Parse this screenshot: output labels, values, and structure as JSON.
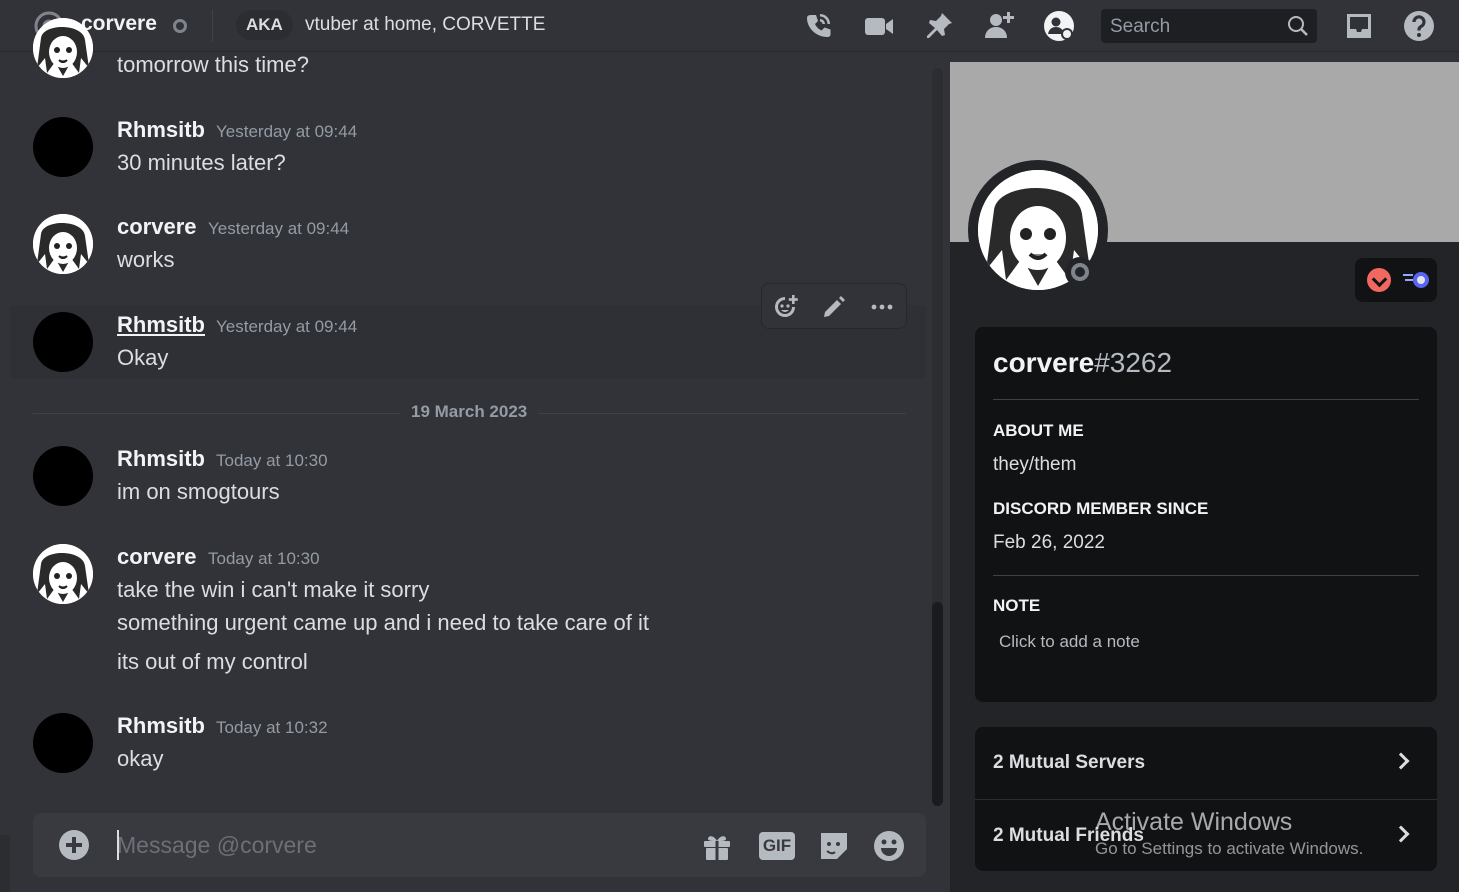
{
  "header": {
    "username": "corvere",
    "aka_label": "AKA",
    "nicknames": "vtuber at home, CORVETTE",
    "search_placeholder": "Search",
    "icons": [
      "at-icon",
      "voice-call-icon",
      "video-call-icon",
      "pin-icon",
      "add-friend-icon",
      "profile-icon",
      "search-icon",
      "inbox-icon",
      "help-icon"
    ]
  },
  "chat": {
    "partial_message": "tomorrow this time?",
    "date_divider": "19 March 2023",
    "composer_placeholder": "Message @corvere",
    "messages": [
      {
        "author": "Rhmsitb",
        "timestamp": "Yesterday at 09:44",
        "lines": [
          "30 minutes later?"
        ]
      },
      {
        "author": "corvere",
        "timestamp": "Yesterday at 09:44",
        "lines": [
          "works"
        ]
      },
      {
        "author": "Rhmsitb",
        "timestamp": "Yesterday at 09:44",
        "lines": [
          "Okay"
        ]
      },
      {
        "author": "Rhmsitb",
        "timestamp": "Today at 10:30",
        "lines": [
          "im on smogtours"
        ]
      },
      {
        "author": "corvere",
        "timestamp": "Today at 10:30",
        "lines": [
          "take the win i can't make it sorry",
          "something urgent came up and i need to take care of it",
          "its out of my control"
        ]
      },
      {
        "author": "Rhmsitb",
        "timestamp": "Today at 10:32",
        "lines": [
          "okay"
        ]
      }
    ]
  },
  "profile": {
    "display_name": "corvere",
    "discriminator": "#3262",
    "about_me_title": "ABOUT ME",
    "about_me": "they/them",
    "member_since_title": "DISCORD MEMBER SINCE",
    "member_since": "Feb 26, 2022",
    "note_title": "NOTE",
    "note_placeholder": "Click to add a note",
    "mutual_servers": "2 Mutual Servers",
    "mutual_friends": "2 Mutual Friends",
    "banner_color": "#a9a9a9"
  },
  "watermark": {
    "line1": "Activate Windows",
    "line2": "Go to Settings to activate Windows."
  }
}
